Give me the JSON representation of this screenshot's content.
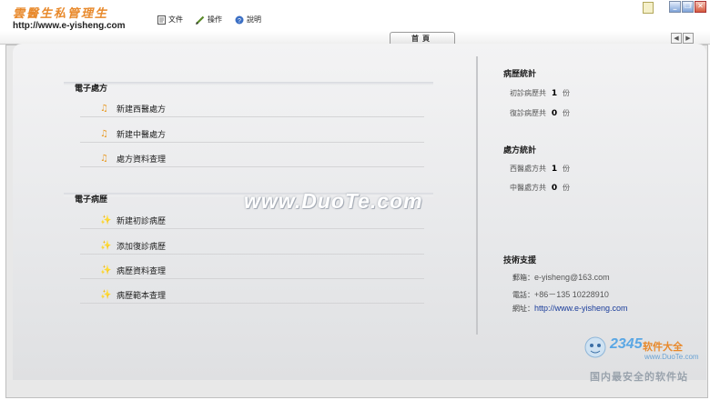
{
  "app": {
    "logo_text": "雲醫生私管理生",
    "logo_url": "http://www.e-yisheng.com"
  },
  "menu": [
    {
      "label": "文件",
      "icon": "document-icon"
    },
    {
      "label": "操作",
      "icon": "pencil-icon"
    },
    {
      "label": "說明",
      "icon": "help-icon"
    }
  ],
  "tabs": [
    {
      "label": "首頁"
    }
  ],
  "prescription_section": {
    "title": "電子處方",
    "items": [
      {
        "label": "新建西醫處方",
        "icon": "music-note-icon"
      },
      {
        "label": "新建中醫處方",
        "icon": "music-note-icon"
      },
      {
        "label": "處方資料查理",
        "icon": "music-note-icon"
      }
    ]
  },
  "record_section": {
    "title": "電子病歷",
    "items": [
      {
        "label": "新建初診病歷",
        "icon": "star-wand-icon"
      },
      {
        "label": "添加復診病歷",
        "icon": "star-wand-icon"
      },
      {
        "label": "病歷資料查理",
        "icon": "star-wand-icon"
      },
      {
        "label": "病歷範本查理",
        "icon": "star-wand-icon"
      }
    ]
  },
  "record_stats": {
    "title": "病歷統計",
    "rows": [
      {
        "label": "初診病歷共",
        "value": "1",
        "unit": "份"
      },
      {
        "label": "復診病歷共",
        "value": "0",
        "unit": "份"
      }
    ]
  },
  "prescription_stats": {
    "title": "處方統計",
    "rows": [
      {
        "label": "西醫處方共",
        "value": "1",
        "unit": "份"
      },
      {
        "label": "中醫處方共",
        "value": "0",
        "unit": "份"
      }
    ]
  },
  "support": {
    "title": "技術支援",
    "email_label": "郵箱：",
    "email": "e-yisheng@163.com",
    "phone_label": "電話：",
    "phone": "+86－135 10228910",
    "web_label": "網址：",
    "web": "http://www.e-yisheng.com"
  },
  "watermark": "www.DuoTe.com",
  "brand": {
    "number": "2345",
    "name": "软件大全",
    "url": "www.DuoTe.com",
    "slogan": "国内最安全的软件站"
  },
  "colors": {
    "accent": "#e8892b",
    "link": "#1a3c9a",
    "panel": "#e8e8ea"
  }
}
